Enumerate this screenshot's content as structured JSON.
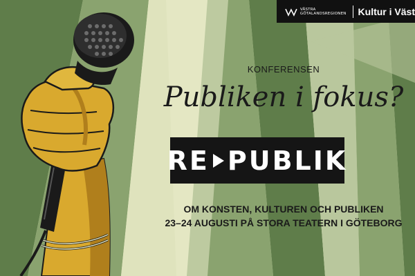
{
  "logo": {
    "org_name": "VÄSTRA GÖTALANDSREGIONEN",
    "brand": "Kultur i Väst",
    "icon": "region-logo-icon"
  },
  "kicker": "KONFERENSEN",
  "title": "Publiken i fokus?",
  "wordmark": {
    "left": "RE",
    "right": "PUBLIK",
    "arrow_icon": "play-arrow-icon"
  },
  "subtitle_line1": "OM KONSTEN, KULTUREN OCH PUBLIKEN",
  "subtitle_line2": "23–24 AUGUSTI PÅ STORA TEATERN I GÖTEBORG",
  "illustration": "hand-holding-microphone",
  "colors": {
    "dark_green": "#5f7d4a",
    "mid_green": "#8aa36f",
    "light_green": "#b9c79d",
    "cream": "#e8ebc8",
    "skin": "#d9a92e",
    "black": "#151515"
  }
}
